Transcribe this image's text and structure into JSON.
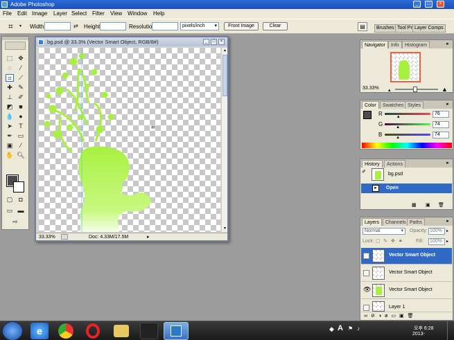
{
  "app": {
    "title": "Adobe Photoshop"
  },
  "window_controls": {
    "minimize": "_",
    "maximize": "□",
    "close": "×"
  },
  "menu": [
    "File",
    "Edit",
    "Image",
    "Layer",
    "Select",
    "Filter",
    "View",
    "Window",
    "Help"
  ],
  "options": {
    "width_label": "Width:",
    "height_label": "Height:",
    "resolution_label": "Resolution:",
    "units_value": "pixels/inch",
    "front_image_label": "Front Image",
    "clear_label": "Clear"
  },
  "palette_well": [
    "Brushes",
    "Tool Pr",
    "Layer Comps"
  ],
  "document": {
    "title": "bg.psd @ 33.3% (Vector Smart Object, RGB/8#)",
    "zoom": "33.33%",
    "doc_size": "Doc: 4.33M/17.5M"
  },
  "navigator": {
    "tabs": [
      "Navigator",
      "Info",
      "Histogram"
    ],
    "zoom": "33.33%"
  },
  "color": {
    "tabs": [
      "Color",
      "Swatches",
      "Styles"
    ],
    "r_label": "R",
    "g_label": "G",
    "b_label": "B",
    "r": "76",
    "g": "74",
    "b": "74",
    "r_fraction": 0.3,
    "g_fraction": 0.29,
    "b_fraction": 0.29,
    "fg_color": "#4c4a4a"
  },
  "history": {
    "tabs": [
      "History",
      "Actions"
    ],
    "snapshot": "bg.psd",
    "items": [
      {
        "label": "Open"
      }
    ]
  },
  "layers": {
    "tabs": [
      "Layers",
      "Channels",
      "Paths"
    ],
    "blend_mode": "Normal",
    "opacity_label": "Opacity:",
    "opacity": "100%",
    "lock_label": "Lock:",
    "fill_label": "Fill:",
    "fill": "100%",
    "items": [
      {
        "name": "Vector Smart Object"
      },
      {
        "name": "Vector Smart Object"
      },
      {
        "name": "Vector Smart Object"
      },
      {
        "name": "Layer 1"
      }
    ]
  },
  "tray": {
    "time": "오후 6:28",
    "date": "2013-"
  },
  "colors": {
    "accent": "#316ac5",
    "artwork_green": "#a8f040"
  }
}
